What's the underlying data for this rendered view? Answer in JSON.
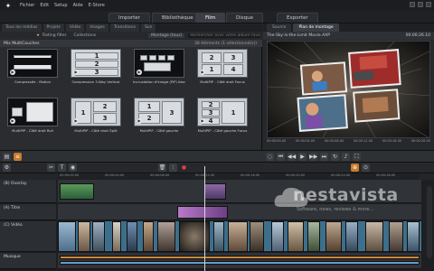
{
  "menu": {
    "items": [
      "Fichier",
      "Edit",
      "Setup",
      "Aide",
      "E-Store"
    ]
  },
  "main_tabs": [
    "Importer",
    "Bibliothèque",
    "Film",
    "Disque",
    "Exporter"
  ],
  "active_tab": "Film",
  "library": {
    "subtabs": [
      "Tous les médias",
      "Projets",
      "Vidéo",
      "Images",
      "Transitions",
      "Son"
    ],
    "toolbar": {
      "rating": "Rating filter",
      "collections": "Collections",
      "mode": "Montage (tous)",
      "search_placeholder": "Rechercher avec votre album favori"
    },
    "header": "Mix MultiCouches",
    "header_info": "38 éléments (1 sélectionné(s))",
    "templates": [
      {
        "label": "Compressée - Motion"
      },
      {
        "label": "Compression 3-Way Vertical"
      },
      {
        "label": "Incrustation d'image (PiP) bloc"
      },
      {
        "label": "MultiPIP - Côté droit Focus"
      },
      {
        "label": "MultiPIP - Côté droit Roll"
      },
      {
        "label": "MultiPIP - Côté droit Split"
      },
      {
        "label": "MultiPIP - Côté gauche"
      },
      {
        "label": "MultiPIP - Côté gauche Focus"
      }
    ]
  },
  "preview": {
    "tabs": [
      "Source",
      "Plan de montage"
    ],
    "title": "The-Sky-is-the-Limit Movie.AXP",
    "timecode": "00:00:26.10",
    "timecode2": "00:00:44.11",
    "ruler": [
      "00:00:00.00",
      "00:00:04.00",
      "00:00:08.00",
      "00:00:12.00",
      "00:00:16.00",
      "00:00:20.00",
      "00:00:24.00"
    ]
  },
  "timeline": {
    "ruler": [
      "00:00:00.00",
      "00:00:04.00",
      "00:00:08.00",
      "00:00:12.00",
      "00:00:16.00",
      "00:00:20.00",
      "00:00:24.00",
      "00:00:28.00",
      "00:00:32.00"
    ],
    "tracks": [
      {
        "name": "(B) Overlay"
      },
      {
        "name": "(A) Titre"
      },
      {
        "name": "(C) Vidéo"
      },
      {
        "name": "Musique"
      }
    ]
  },
  "watermark": {
    "text": "nestavista",
    "sub": "Software, news, reviews & more..."
  },
  "colors": {
    "accent": "#c97a2a",
    "panel": "#2a2c30",
    "active_tab": "#3b3f45"
  }
}
